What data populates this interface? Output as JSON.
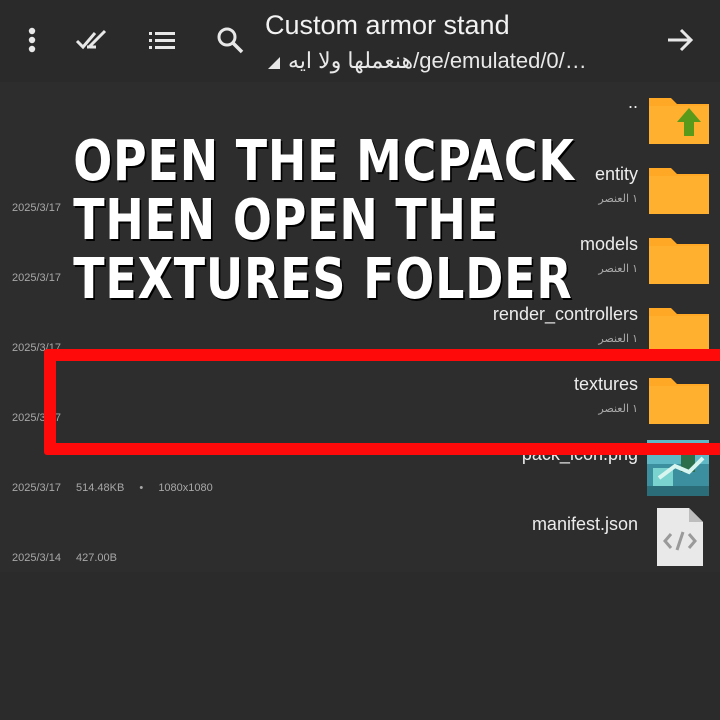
{
  "header": {
    "title": "Custom armor stand",
    "path": "هنعملها ولا ايه/ge/emulated/0/…"
  },
  "files": [
    {
      "name": "..",
      "sub": "",
      "meta": "",
      "kind": "parent"
    },
    {
      "name": "entity",
      "sub": "١ العنصر",
      "meta": "2025/3/17",
      "kind": "folder"
    },
    {
      "name": "models",
      "sub": "١ العنصر",
      "meta": "2025/3/17",
      "kind": "folder"
    },
    {
      "name": "render_controllers",
      "sub": "١ العنصر",
      "meta": "2025/3/17",
      "kind": "folder"
    },
    {
      "name": "textures",
      "sub": "١ العنصر",
      "meta": "2025/3/17",
      "kind": "folder"
    },
    {
      "name": "pack_icon.png",
      "sub": "",
      "meta_date": "2025/3/17",
      "meta_size": "514.48KB",
      "meta_dim": "1080x1080",
      "kind": "image"
    },
    {
      "name": "manifest.json",
      "sub": "",
      "meta_date": "2025/3/14",
      "meta_size": "427.00B",
      "kind": "code"
    }
  ],
  "overlay": {
    "line1": "OPEN THE MCPACK",
    "line2": "THEN OPEN THE",
    "line3": "TEXTURES FOLDER"
  },
  "colors": {
    "folder": "#ffa825",
    "highlight": "#ff0a0a",
    "arrow": "#5a9a1a",
    "background": "#2b2b2b"
  }
}
